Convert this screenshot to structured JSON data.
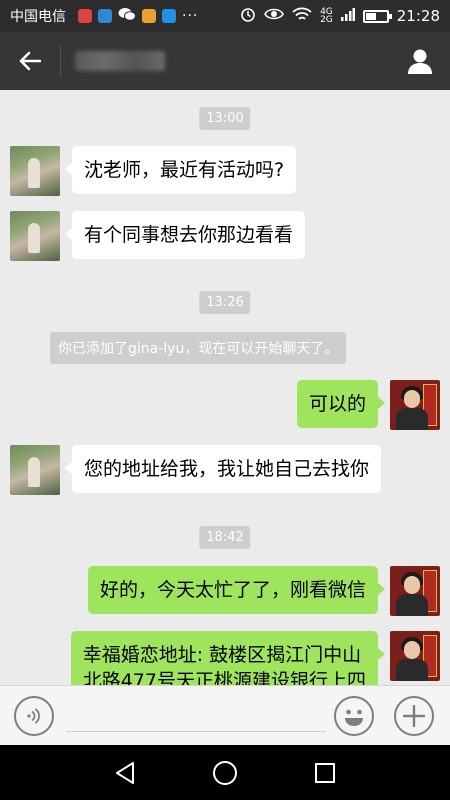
{
  "status_bar": {
    "carrier": "中国电信",
    "time": "21:28",
    "net_top": "4G",
    "net_bottom": "2G",
    "dots": "···",
    "battery_level": 0.45
  },
  "header": {
    "back_icon": "arrow-left-icon",
    "profile_icon": "person-icon"
  },
  "messages": [
    {
      "type": "time",
      "text": "13:00"
    },
    {
      "type": "incoming",
      "text": "沈老师，最近有活动吗?"
    },
    {
      "type": "incoming",
      "text": "有个同事想去你那边看看"
    },
    {
      "type": "time",
      "text": "13:26"
    },
    {
      "type": "system",
      "text": "你已添加了gina-lyu，现在可以开始聊天了。"
    },
    {
      "type": "outgoing",
      "text": "可以的"
    },
    {
      "type": "incoming",
      "text": "您的地址给我，我让她自己去找你"
    },
    {
      "type": "time",
      "text": "18:42"
    },
    {
      "type": "outgoing",
      "text": "好的，今天太忙了了，刚看微信"
    },
    {
      "type": "outgoing",
      "line1": "幸福婚恋地址: 鼓楼区揭江门中山",
      "line2": "北路477号天正桃源建设银行上四"
    }
  ],
  "input_bar": {
    "placeholder": "",
    "voice_icon": "voice-icon",
    "emoji_icon": "emoji-icon",
    "plus_icon": "plus-icon"
  },
  "colors": {
    "title_bar": "#363636",
    "chat_bg": "#ebebeb",
    "outgoing_bubble": "#9fe45d",
    "incoming_bubble": "#ffffff"
  }
}
